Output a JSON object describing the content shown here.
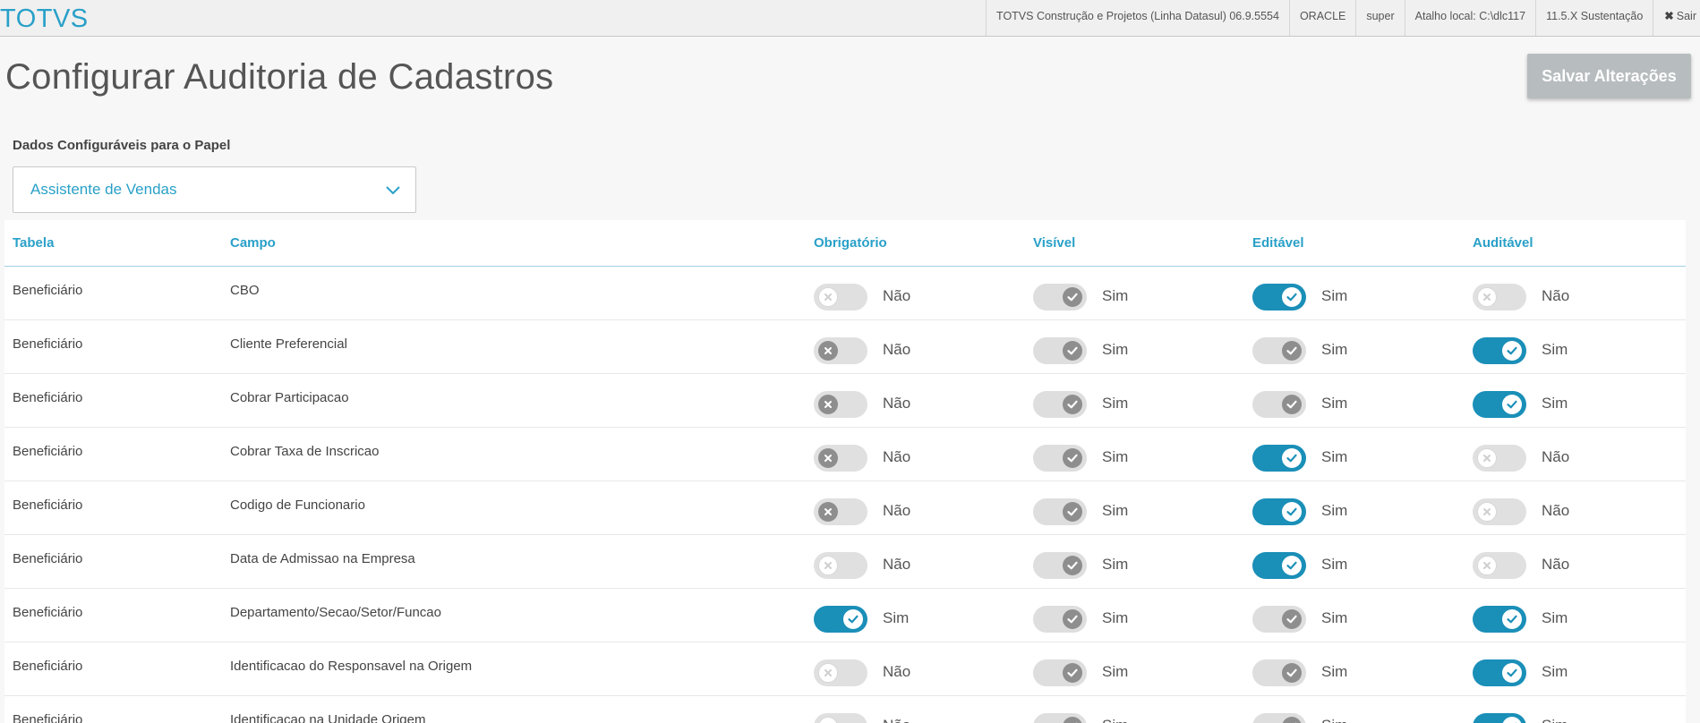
{
  "header": {
    "brand": "TOTVS",
    "product": "TOTVS Construção e Projetos (Linha Datasul) 06.9.5554",
    "db": "ORACLE",
    "user": "super",
    "shortcut": "Atalho local: C:\\dlc117",
    "version": "11.5.X Sustentação",
    "exit_label": "Sair"
  },
  "page": {
    "title": "Configurar Auditoria de Cadastros",
    "save_label": "Salvar Alterações",
    "role_label": "Dados Configuráveis para o Papel",
    "role_value": "Assistente de Vendas"
  },
  "table": {
    "columns": [
      "Tabela",
      "Campo",
      "Obrigatório",
      "Visível",
      "Editável",
      "Auditável"
    ],
    "rows": [
      {
        "tabela": "Beneficiário",
        "campo": "CBO",
        "obrigatorio": {
          "state": "free-off",
          "label": "Não"
        },
        "visivel": {
          "state": "disabled-on",
          "label": "Sim"
        },
        "editavel": {
          "state": "on",
          "label": "Sim"
        },
        "auditavel": {
          "state": "free-off",
          "label": "Não"
        }
      },
      {
        "tabela": "Beneficiário",
        "campo": "Cliente Preferencial",
        "obrigatorio": {
          "state": "locked-off",
          "label": "Não"
        },
        "visivel": {
          "state": "disabled-on",
          "label": "Sim"
        },
        "editavel": {
          "state": "disabled-on",
          "label": "Sim"
        },
        "auditavel": {
          "state": "on",
          "label": "Sim"
        }
      },
      {
        "tabela": "Beneficiário",
        "campo": "Cobrar Participacao",
        "obrigatorio": {
          "state": "locked-off",
          "label": "Não"
        },
        "visivel": {
          "state": "disabled-on",
          "label": "Sim"
        },
        "editavel": {
          "state": "disabled-on",
          "label": "Sim"
        },
        "auditavel": {
          "state": "on",
          "label": "Sim"
        }
      },
      {
        "tabela": "Beneficiário",
        "campo": "Cobrar Taxa de Inscricao",
        "obrigatorio": {
          "state": "locked-off",
          "label": "Não"
        },
        "visivel": {
          "state": "disabled-on",
          "label": "Sim"
        },
        "editavel": {
          "state": "on",
          "label": "Sim"
        },
        "auditavel": {
          "state": "free-off",
          "label": "Não"
        }
      },
      {
        "tabela": "Beneficiário",
        "campo": "Codigo de Funcionario",
        "obrigatorio": {
          "state": "locked-off",
          "label": "Não"
        },
        "visivel": {
          "state": "disabled-on",
          "label": "Sim"
        },
        "editavel": {
          "state": "on",
          "label": "Sim"
        },
        "auditavel": {
          "state": "free-off",
          "label": "Não"
        }
      },
      {
        "tabela": "Beneficiário",
        "campo": "Data de Admissao na Empresa",
        "obrigatorio": {
          "state": "free-off",
          "label": "Não"
        },
        "visivel": {
          "state": "disabled-on",
          "label": "Sim"
        },
        "editavel": {
          "state": "on",
          "label": "Sim"
        },
        "auditavel": {
          "state": "free-off",
          "label": "Não"
        }
      },
      {
        "tabela": "Beneficiário",
        "campo": "Departamento/Secao/Setor/Funcao",
        "obrigatorio": {
          "state": "on",
          "label": "Sim"
        },
        "visivel": {
          "state": "disabled-on",
          "label": "Sim"
        },
        "editavel": {
          "state": "disabled-on",
          "label": "Sim"
        },
        "auditavel": {
          "state": "on",
          "label": "Sim"
        }
      },
      {
        "tabela": "Beneficiário",
        "campo": "Identificacao do Responsavel na Origem",
        "obrigatorio": {
          "state": "free-off",
          "label": "Não"
        },
        "visivel": {
          "state": "disabled-on",
          "label": "Sim"
        },
        "editavel": {
          "state": "disabled-on",
          "label": "Sim"
        },
        "auditavel": {
          "state": "on",
          "label": "Sim"
        }
      },
      {
        "tabela": "Beneficiário",
        "campo": "Identificacao na Unidade Origem",
        "obrigatorio": {
          "state": "free-off",
          "label": "Não"
        },
        "visivel": {
          "state": "disabled-on",
          "label": "Sim"
        },
        "editavel": {
          "state": "disabled-on",
          "label": "Sim"
        },
        "auditavel": {
          "state": "on",
          "label": "Sim"
        }
      }
    ]
  },
  "colors": {
    "accent": "#29a0c8",
    "toggle_on": "#1a8fb8",
    "button_disabled": "#b7bcbf"
  }
}
